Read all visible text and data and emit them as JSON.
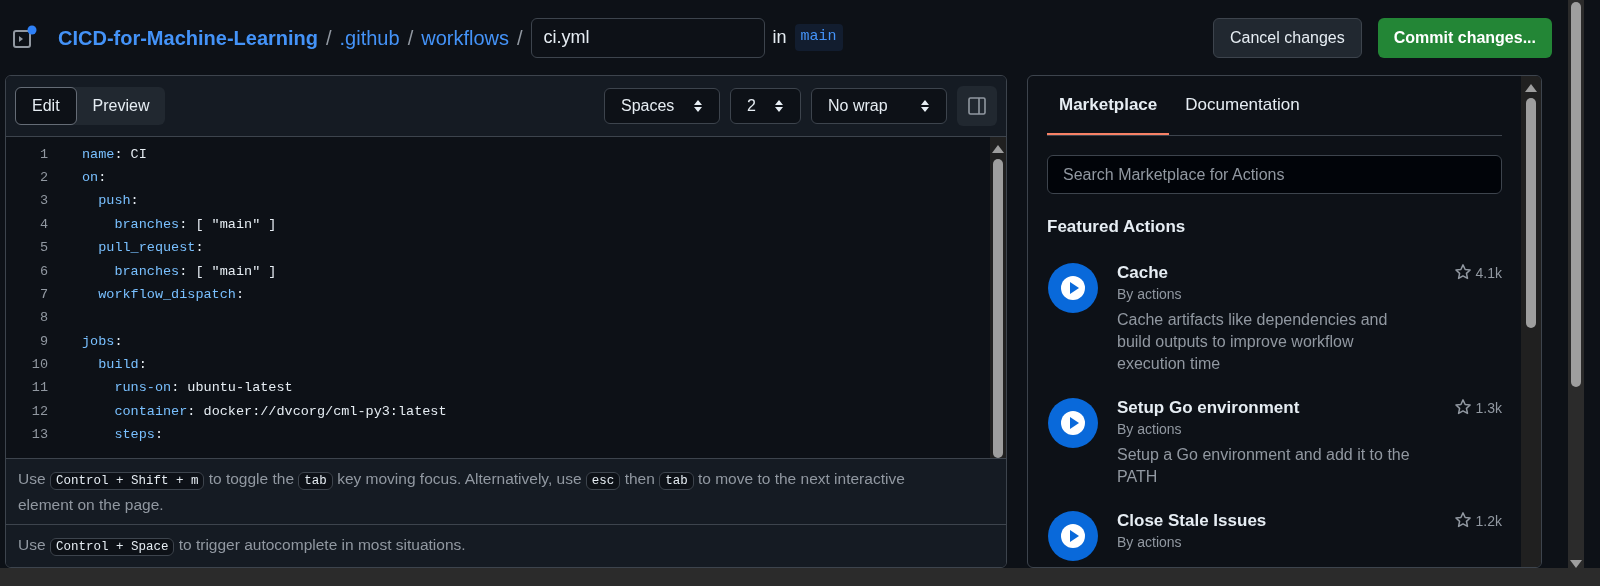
{
  "breadcrumb": {
    "repo": "CICD-for-Machine-Learning",
    "separators": [
      "/",
      "/",
      "/"
    ],
    "folders": [
      ".github",
      "workflows"
    ],
    "filename": "ci.yml",
    "in_label": "in",
    "branch": "main"
  },
  "actions": [
    {
      "label": "Cancel changes",
      "kind": "secondary"
    },
    {
      "label": "Commit changes...",
      "kind": "primary"
    }
  ],
  "editor": {
    "tabs": [
      {
        "label": "Edit",
        "selected": true
      },
      {
        "label": "Preview",
        "selected": false
      }
    ],
    "selects": [
      "Spaces",
      "2",
      "No wrap"
    ],
    "lines": [
      {
        "number": "1",
        "key": "name",
        "rest": ": CI"
      },
      {
        "number": "2",
        "key": "on",
        "rest": ":"
      },
      {
        "number": "3",
        "key": "  push",
        "rest": ":"
      },
      {
        "number": "4",
        "key": "    branches",
        "rest": ": [ \"main\" ]"
      },
      {
        "number": "5",
        "key": "  pull_request",
        "rest": ":"
      },
      {
        "number": "6",
        "key": "    branches",
        "rest": ": [ \"main\" ]"
      },
      {
        "number": "7",
        "key": "  workflow_dispatch",
        "rest": ":"
      },
      {
        "number": "8"
      },
      {
        "number": "9",
        "key": "jobs",
        "rest": ":"
      },
      {
        "number": "10",
        "key": "  build",
        "rest": ":"
      },
      {
        "number": "11",
        "key": "    runs-on",
        "rest": ": ubuntu-latest"
      },
      {
        "number": "12",
        "key": "    container",
        "rest": ": docker://dvcorg/cml-py3:latest"
      },
      {
        "number": "13",
        "key": "    steps",
        "rest": ":"
      }
    ],
    "hints": [
      [
        {
          "kind": "text",
          "text": "Use "
        },
        {
          "kind": "kbd",
          "text": "Control + Shift + m"
        },
        {
          "kind": "text",
          "text": " to toggle the "
        },
        {
          "kind": "kbd",
          "text": "tab"
        },
        {
          "kind": "text",
          "text": " key moving focus. Alternatively, use "
        },
        {
          "kind": "kbd",
          "text": "esc"
        },
        {
          "kind": "text",
          "text": " then "
        },
        {
          "kind": "kbd",
          "text": "tab"
        },
        {
          "kind": "text",
          "text": " to move to the next interactive element on the page."
        }
      ],
      [
        {
          "kind": "text",
          "text": "Use "
        },
        {
          "kind": "kbd",
          "text": "Control + Space"
        },
        {
          "kind": "text",
          "text": " to trigger autocomplete in most situations."
        }
      ]
    ]
  },
  "sidebar": {
    "tabs": [
      {
        "label": "Marketplace",
        "selected": true
      },
      {
        "label": "Documentation",
        "selected": false
      }
    ],
    "search": {
      "placeholder": "Search Marketplace for Actions"
    },
    "heading": "Featured Actions",
    "items": [
      {
        "title": "Cache",
        "author": "By actions",
        "description": "Cache artifacts like dependencies and build outputs to improve workflow execution time",
        "stars": "4.1k"
      },
      {
        "title": "Setup Go environment",
        "author": "By actions",
        "description": "Setup a Go environment and add it to the PATH",
        "stars": "1.3k"
      },
      {
        "title": "Close Stale Issues",
        "author": "By actions",
        "stars": "1.2k"
      }
    ]
  }
}
